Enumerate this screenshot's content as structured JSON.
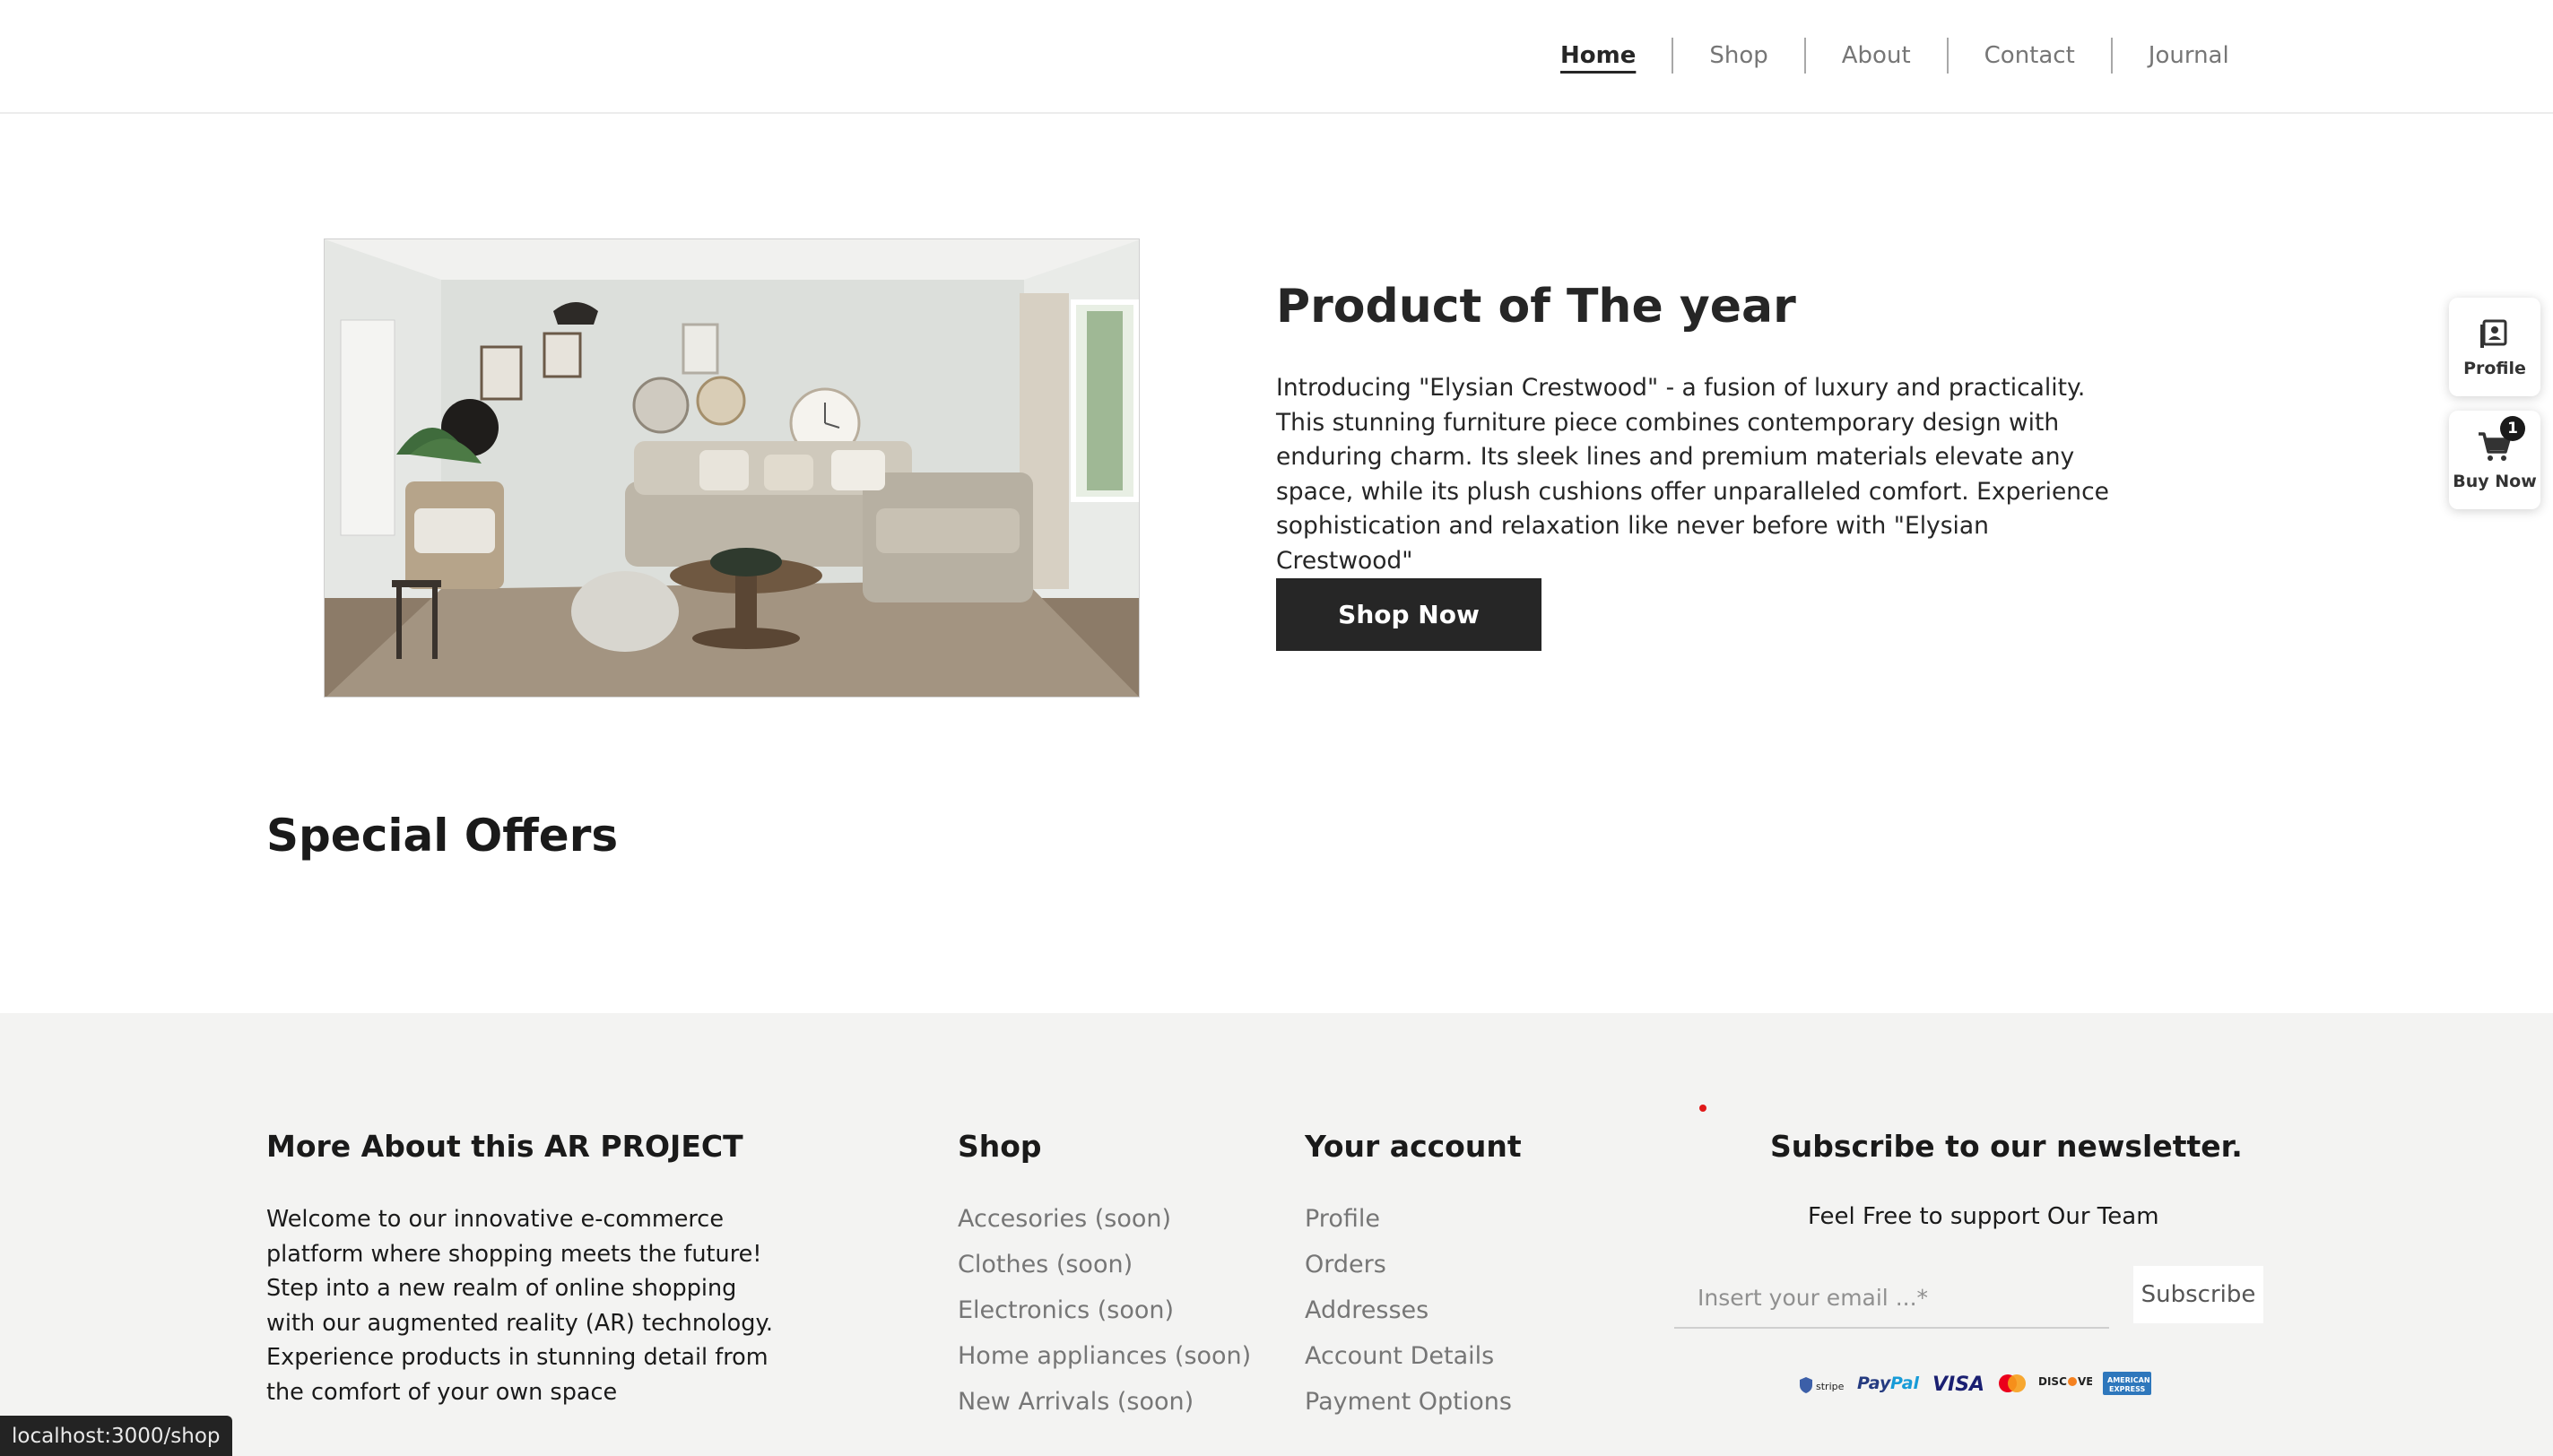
{
  "nav": {
    "items": [
      {
        "label": "Home",
        "active": true
      },
      {
        "label": "Shop"
      },
      {
        "label": "About"
      },
      {
        "label": "Contact"
      },
      {
        "label": "Journal"
      }
    ]
  },
  "hero": {
    "title": "Product of The year",
    "description": "Introducing \"Elysian Crestwood\" - a fusion of luxury and practicality. This stunning furniture piece combines contemporary design with enduring charm. Its sleek lines and premium materials elevate any space, while its plush cushions offer unparalleled comfort. Experience sophistication and relaxation like never before with \"Elysian Crestwood\"",
    "button": "Shop Now",
    "image_icon": "living-room-photo"
  },
  "special_offers": {
    "title": "Special Offers"
  },
  "side": {
    "profile_label": "Profile",
    "profile_icon": "contact-book-icon",
    "cart_label": "Buy Now",
    "cart_icon": "shopping-cart-icon",
    "cart_count": "1"
  },
  "footer": {
    "about": {
      "title": "More About this AR PROJECT",
      "text": "Welcome to our innovative e-commerce platform where shopping meets the future! Step into a new realm of online shopping with our augmented reality (AR) technology. Experience products in stunning detail from the comfort of your own space"
    },
    "shop": {
      "title": "Shop",
      "links": [
        "Accesories (soon)",
        "Clothes (soon)",
        "Electronics (soon)",
        "Home appliances (soon)",
        "New Arrivals (soon)"
      ]
    },
    "account": {
      "title": "Your account",
      "links": [
        "Profile",
        "Orders",
        "Addresses",
        "Account Details",
        "Payment Options"
      ]
    },
    "newsletter": {
      "title": "Subscribe to our newsletter.",
      "text": "Feel Free to support Our Team",
      "placeholder": "Insert your email ...*",
      "button": "Subscribe",
      "payments": [
        "Stripe",
        "PayPal",
        "VISA",
        "Mastercard",
        "DISCOVER",
        "American Express"
      ]
    }
  },
  "status_bar": {
    "url": "localhost:3000/shop"
  },
  "colors": {
    "dark": "#262626",
    "footer_bg": "#f3f3f2",
    "muted": "#767676",
    "accent_red": "#e01919"
  }
}
